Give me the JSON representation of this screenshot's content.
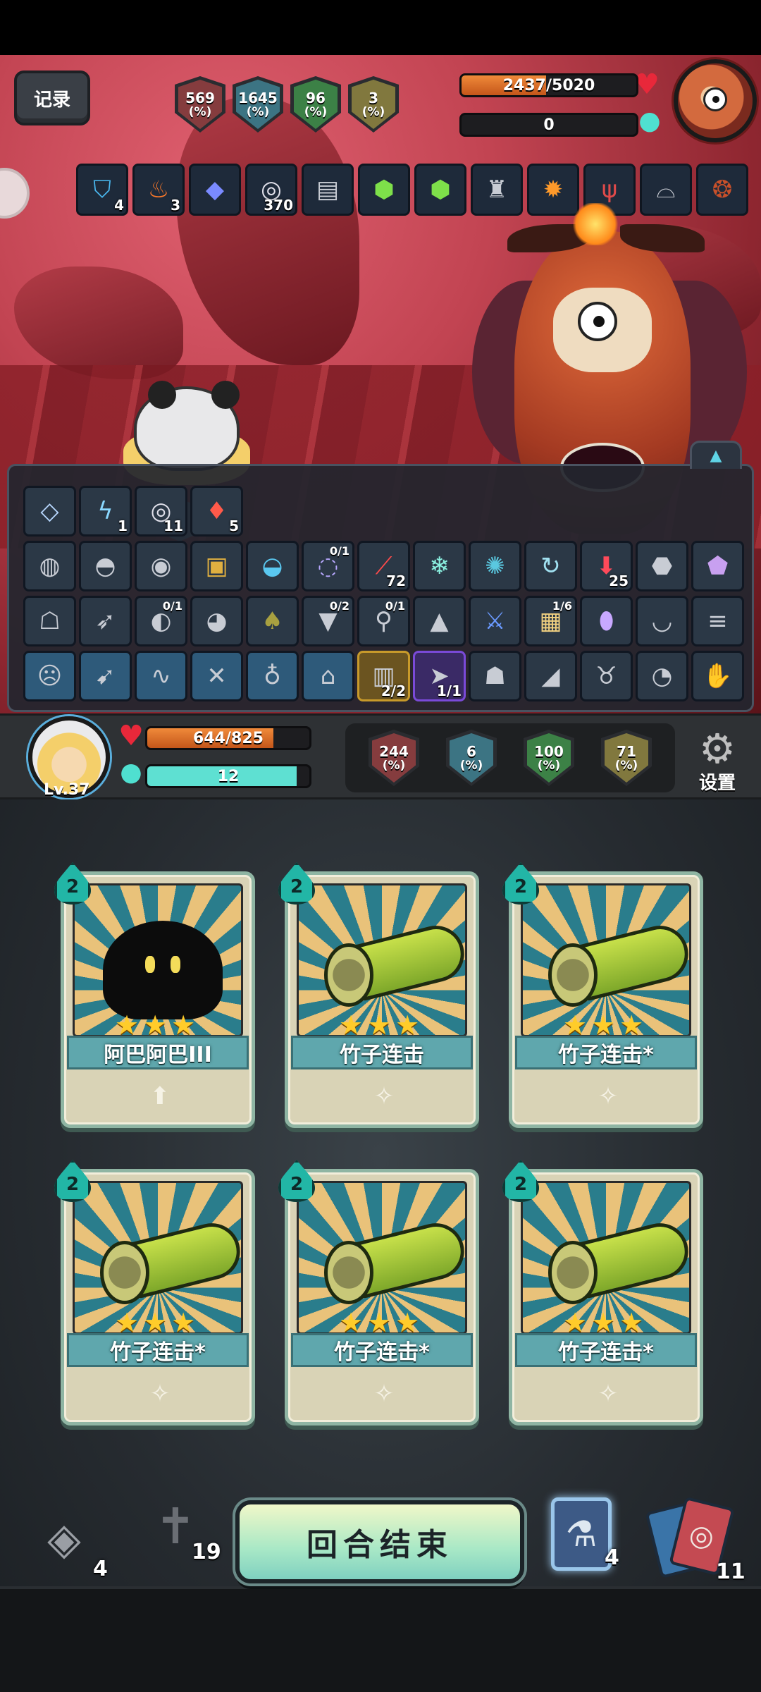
{
  "top_log_button": "记录",
  "enemy": {
    "hp_text": "2437/5020",
    "hp_fraction": 0.485,
    "mana_text": "0",
    "mana_fraction": 0.0,
    "stats": [
      {
        "icon": "attack-shield-icon",
        "value": "569",
        "unit": "(%)",
        "color": "#d04a4a"
      },
      {
        "icon": "crit-shield-icon",
        "value": "1645",
        "unit": "(%)",
        "color": "#4ab0c8"
      },
      {
        "icon": "defense-shield-icon",
        "value": "96",
        "unit": "(%)",
        "color": "#4ac85a"
      },
      {
        "icon": "speed-shield-icon",
        "value": "3",
        "unit": "(%)",
        "color": "#c8b84a"
      }
    ],
    "buffs": [
      {
        "icon": "blue-shield-icon",
        "count": "4"
      },
      {
        "icon": "fire-icon",
        "count": "3"
      },
      {
        "icon": "gem-icon",
        "count": ""
      },
      {
        "icon": "spiral-icon",
        "count": "370"
      },
      {
        "icon": "book-icon",
        "count": ""
      },
      {
        "icon": "green-rock-icon",
        "count": ""
      },
      {
        "icon": "green-rock-icon",
        "count": ""
      },
      {
        "icon": "castle-icon",
        "count": ""
      },
      {
        "icon": "torch-icon",
        "count": ""
      },
      {
        "icon": "claw-icon",
        "count": ""
      },
      {
        "icon": "wing-icon",
        "count": ""
      },
      {
        "icon": "beads-icon",
        "count": ""
      }
    ]
  },
  "inventory": {
    "row1": [
      {
        "icon": "crystal-icon",
        "count": ""
      },
      {
        "icon": "lightning-icon",
        "count": "1"
      },
      {
        "icon": "spiral-icon",
        "count": "11"
      },
      {
        "icon": "blood-drop-icon",
        "count": "5"
      }
    ],
    "row2": [
      {
        "icon": "drum-icon",
        "count": ""
      },
      {
        "icon": "helmet-icon",
        "count": ""
      },
      {
        "icon": "bell-icon",
        "count": ""
      },
      {
        "icon": "chest-icon",
        "count": ""
      },
      {
        "icon": "water-icon",
        "count": ""
      },
      {
        "icon": "galaxy-icon",
        "count": "",
        "tag": "0/1"
      },
      {
        "icon": "slash-icon",
        "count": "72"
      },
      {
        "icon": "ice-crystal-icon",
        "count": ""
      },
      {
        "icon": "web-icon",
        "count": ""
      },
      {
        "icon": "swirl-icon",
        "count": ""
      },
      {
        "icon": "down-arrow-icon",
        "count": "25"
      },
      {
        "icon": "dark-gem-icon",
        "count": ""
      },
      {
        "icon": "purple-crystal-icon",
        "count": ""
      }
    ],
    "row3": [
      {
        "icon": "ghost-icon",
        "count": ""
      },
      {
        "icon": "kunai-icon",
        "count": ""
      },
      {
        "icon": "pouch-icon",
        "count": "",
        "tag": "0/1"
      },
      {
        "icon": "owl-icon",
        "count": ""
      },
      {
        "icon": "mushroom-icon",
        "count": ""
      },
      {
        "icon": "armor-icon",
        "count": "",
        "tag": "0/2"
      },
      {
        "icon": "pacifier-icon",
        "count": "",
        "tag": "0/1"
      },
      {
        "icon": "gnome-icon",
        "count": ""
      },
      {
        "icon": "sword-icon",
        "count": ""
      },
      {
        "icon": "scroll-icon",
        "count": "",
        "tag": "1/6"
      },
      {
        "icon": "egg-icon",
        "count": ""
      },
      {
        "icon": "bowl-icon",
        "count": ""
      },
      {
        "icon": "mummy-icon",
        "count": ""
      }
    ],
    "row4": [
      {
        "icon": "mask-icon",
        "count": "",
        "style": "blue"
      },
      {
        "icon": "bow-icon",
        "count": "",
        "style": "blue"
      },
      {
        "icon": "dragon-icon",
        "count": "",
        "style": "blue"
      },
      {
        "icon": "crossed-swords-icon",
        "count": "",
        "style": "blue"
      },
      {
        "icon": "potion-rune-icon",
        "count": "",
        "style": "blue"
      },
      {
        "icon": "helm-rune-icon",
        "count": "",
        "style": "blue"
      },
      {
        "icon": "scroll-gold-icon",
        "count": "2/2",
        "style": "gold"
      },
      {
        "icon": "bullet-icon",
        "count": "1/1",
        "style": "purple"
      },
      {
        "icon": "figure-icon",
        "count": ""
      },
      {
        "icon": "cleaver-icon",
        "count": ""
      },
      {
        "icon": "pig-icon",
        "count": ""
      },
      {
        "icon": "sack-icon",
        "count": ""
      },
      {
        "icon": "gauntlet-icon",
        "count": ""
      }
    ]
  },
  "player": {
    "level": "Lv.37",
    "hp_text": "644/825",
    "hp_fraction": 0.78,
    "mana_text": "12",
    "mana_fraction": 0.92,
    "stats": [
      {
        "icon": "attack-shield-icon",
        "value": "244",
        "unit": "(%)",
        "color": "#d04a4a"
      },
      {
        "icon": "crit-shield-icon",
        "value": "6",
        "unit": "(%)",
        "color": "#4ab0c8"
      },
      {
        "icon": "defense-shield-icon",
        "value": "100",
        "unit": "(%)",
        "color": "#4ac85a"
      },
      {
        "icon": "speed-shield-icon",
        "value": "71",
        "unit": "(%)",
        "color": "#c8b84a"
      }
    ],
    "settings_label": "设置"
  },
  "hand": [
    {
      "cost": "2",
      "name": "阿巴阿巴III",
      "art": "shadow-blob",
      "foot_icon": "upgrade-arrow-icon"
    },
    {
      "cost": "2",
      "name": "竹子连击",
      "art": "bamboo",
      "foot_icon": "whistle-icon"
    },
    {
      "cost": "2",
      "name": "竹子连击*",
      "art": "bamboo",
      "foot_icon": "whistle-icon"
    },
    {
      "cost": "2",
      "name": "竹子连击*",
      "art": "bamboo",
      "foot_icon": "whistle-icon"
    },
    {
      "cost": "2",
      "name": "竹子连击*",
      "art": "bamboo",
      "foot_icon": "whistle-icon"
    },
    {
      "cost": "2",
      "name": "竹子连击*",
      "art": "bamboo",
      "foot_icon": "whistle-icon"
    }
  ],
  "bottom": {
    "draw_pile_count": "4",
    "discard_pile_count": "19",
    "end_turn_label": "回合结束",
    "potion_count": "4",
    "deck_count": "11"
  }
}
